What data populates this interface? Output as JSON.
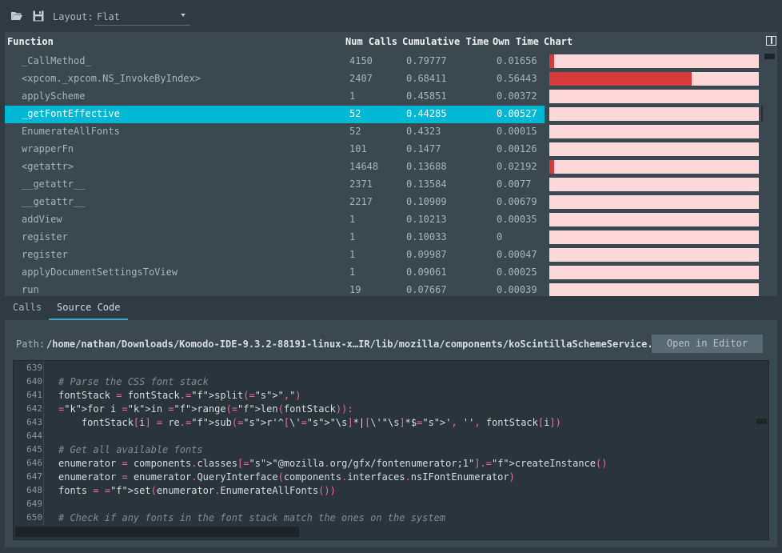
{
  "toolbar": {
    "open_icon": "folder-open-icon",
    "save_icon": "save-icon",
    "layout_label": "Layout:",
    "layout_value": "Flat"
  },
  "table": {
    "headers": {
      "function": "Function",
      "num_calls": "Num Calls",
      "cumulative_time": "Cumulative Time",
      "own_time": "Own Time",
      "chart": "Chart"
    },
    "rows": [
      {
        "function": "_CallMethod_",
        "calls": "4150",
        "cumulative": "0.79777",
        "own": "0.01656",
        "chart_fill": 0.021
      },
      {
        "function": "<xpcom._xpcom.NS_InvokeByIndex>",
        "calls": "2407",
        "cumulative": "0.68411",
        "own": "0.56443",
        "chart_fill": 0.678
      },
      {
        "function": "applyScheme",
        "calls": "1",
        "cumulative": "0.45851",
        "own": "0.00372",
        "chart_fill": 0
      },
      {
        "function": "_getFontEffective",
        "calls": "52",
        "cumulative": "0.44285",
        "own": "0.00527",
        "chart_fill": 0
      },
      {
        "function": "EnumerateAllFonts",
        "calls": "52",
        "cumulative": "0.4323",
        "own": "0.00015",
        "chart_fill": 0
      },
      {
        "function": "wrapperFn",
        "calls": "101",
        "cumulative": "0.1477",
        "own": "0.00126",
        "chart_fill": 0
      },
      {
        "function": "<getattr>",
        "calls": "14648",
        "cumulative": "0.13688",
        "own": "0.02192",
        "chart_fill": 0.021
      },
      {
        "function": "__getattr__",
        "calls": "2371",
        "cumulative": "0.13584",
        "own": "0.0077",
        "chart_fill": 0
      },
      {
        "function": "__getattr__",
        "calls": "2217",
        "cumulative": "0.10909",
        "own": "0.00679",
        "chart_fill": 0
      },
      {
        "function": "addView",
        "calls": "1",
        "cumulative": "0.10213",
        "own": "0.00035",
        "chart_fill": 0
      },
      {
        "function": "register",
        "calls": "1",
        "cumulative": "0.10033",
        "own": "0",
        "chart_fill": 0
      },
      {
        "function": "register",
        "calls": "1",
        "cumulative": "0.09987",
        "own": "0.00047",
        "chart_fill": 0
      },
      {
        "function": "applyDocumentSettingsToView",
        "calls": "1",
        "cumulative": "0.09061",
        "own": "0.00025",
        "chart_fill": 0
      },
      {
        "function": "run",
        "calls": "19",
        "cumulative": "0.07667",
        "own": "0.00039",
        "chart_fill": 0
      }
    ],
    "selected_index": 3
  },
  "tabs": [
    {
      "label": "Calls",
      "active": false
    },
    {
      "label": "Source Code",
      "active": true
    }
  ],
  "source": {
    "path_label": "Path:",
    "path_value": "/home/nathan/Downloads/Komodo-IDE-9.3.2-88191-linux-x…IR/lib/mozilla/components/koScintillaSchemeService.py",
    "open_button": "Open in Editor",
    "lines": [
      {
        "num": "639",
        "code": ""
      },
      {
        "num": "640",
        "code": "# Parse the CSS font stack"
      },
      {
        "num": "641",
        "code": "fontStack = fontStack.split(\",\")"
      },
      {
        "num": "642",
        "code": "for i in range(len(fontStack)):"
      },
      {
        "num": "643",
        "code": "    fontStack[i] = re.sub(r'^[\\'\"\\s]*|[\\'\"\\s]*$', '', fontStack[i])"
      },
      {
        "num": "644",
        "code": ""
      },
      {
        "num": "645",
        "code": "# Get all available fonts"
      },
      {
        "num": "646",
        "code": "enumerator = components.classes[\"@mozilla.org/gfx/fontenumerator;1\"].createInstance()"
      },
      {
        "num": "647",
        "code": "enumerator = enumerator.QueryInterface(components.interfaces.nsIFontEnumerator)"
      },
      {
        "num": "648",
        "code": "fonts = set(enumerator.EnumerateAllFonts())"
      },
      {
        "num": "649",
        "code": ""
      },
      {
        "num": "650",
        "code": "# Check if any fonts in the font stack match the ones on the system"
      }
    ]
  },
  "colors": {
    "background": "#2f3a42",
    "panel": "#3a4850",
    "selected_row": "#00b8d4",
    "chart_track": "#ffd9d9",
    "chart_fill": "#d63a3a",
    "keyword": "#2fa9e0",
    "function": "#f06aa0",
    "string": "#e0d870",
    "comment": "#7f8d95"
  }
}
